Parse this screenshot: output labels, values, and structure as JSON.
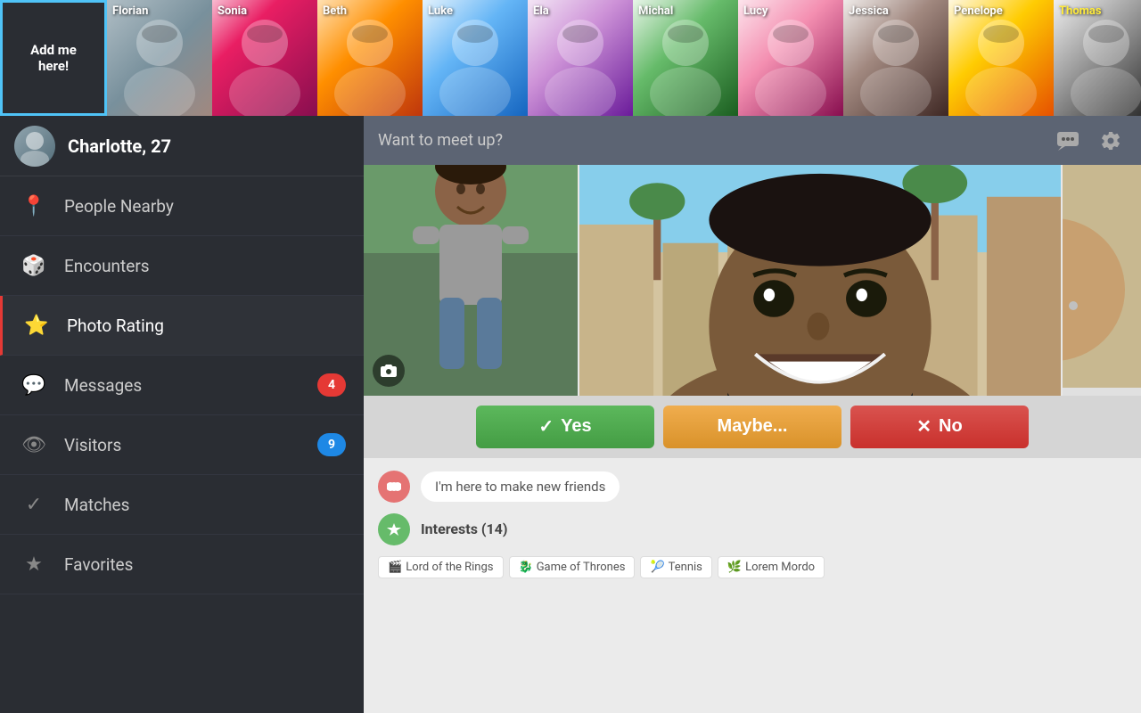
{
  "topBar": {
    "addMe": "Add me\nhere!",
    "avatars": [
      {
        "name": "Florian",
        "photoClass": "photo-florian"
      },
      {
        "name": "Sonia",
        "photoClass": "photo-sonia"
      },
      {
        "name": "Beth",
        "photoClass": "photo-beth"
      },
      {
        "name": "Luke",
        "photoClass": "photo-luke"
      },
      {
        "name": "Ela",
        "photoClass": "photo-ela"
      },
      {
        "name": "Michal",
        "photoClass": "photo-michal"
      },
      {
        "name": "Lucy",
        "photoClass": "photo-lucy"
      },
      {
        "name": "Jessica",
        "photoClass": "photo-jessica"
      },
      {
        "name": "Penelope",
        "photoClass": "photo-penelope"
      },
      {
        "name": "Thomas",
        "photoClass": "photo-thomas",
        "highlight": true
      }
    ]
  },
  "sidebar": {
    "profile": {
      "name": "Charlotte, 27"
    },
    "navItems": [
      {
        "id": "people-nearby",
        "label": "People Nearby",
        "icon": "📍",
        "badge": null
      },
      {
        "id": "encounters",
        "label": "Encounters",
        "icon": "🎲",
        "badge": null
      },
      {
        "id": "photo-rating",
        "label": "Photo Rating",
        "icon": "⭐",
        "badge": null,
        "active": true
      },
      {
        "id": "messages",
        "label": "Messages",
        "icon": "💬",
        "badge": "4",
        "badgeType": "red"
      },
      {
        "id": "visitors",
        "label": "Visitors",
        "icon": "👁",
        "badge": "9",
        "badgeType": "blue"
      },
      {
        "id": "matches",
        "label": "Matches",
        "icon": "✓",
        "badge": null
      },
      {
        "id": "favorites",
        "label": "Favorites",
        "icon": "★",
        "badge": null
      }
    ]
  },
  "header": {
    "title": "Want to meet up?",
    "chatIcon": "💬",
    "settingsIcon": "⚙"
  },
  "actionButtons": {
    "yes": "Yes",
    "maybe": "Maybe...",
    "no": "No"
  },
  "profileInfo": {
    "statusText": "I'm here to make new friends",
    "interestsLabel": "Interests (14)",
    "interestCount": 14,
    "interests": [
      {
        "icon": "🎬",
        "label": "Lord of the Rings"
      },
      {
        "icon": "🐉",
        "label": "Game of Thrones"
      },
      {
        "icon": "🎾",
        "label": "Tennis"
      },
      {
        "icon": "🌿",
        "label": "Lorem Mordo"
      }
    ]
  }
}
